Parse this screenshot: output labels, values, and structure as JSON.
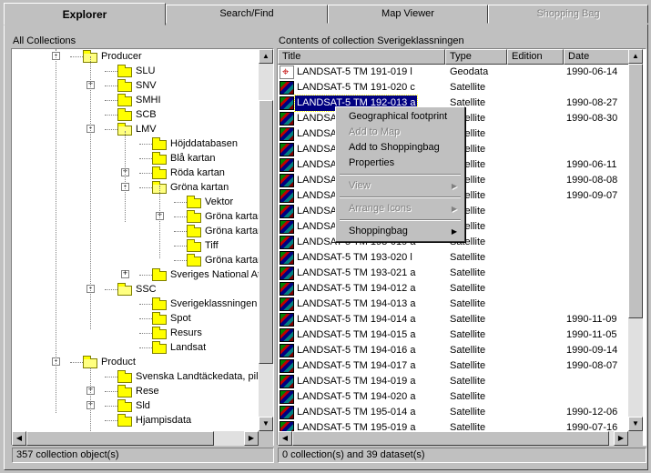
{
  "tabs": [
    {
      "label": "Explorer",
      "state": "active"
    },
    {
      "label": "Search/Find",
      "state": "normal"
    },
    {
      "label": "Map Viewer",
      "state": "normal"
    },
    {
      "label": "Shopping Bag",
      "state": "disabled"
    }
  ],
  "left": {
    "header": "All Collections",
    "status": "357 collection object(s)",
    "tree": [
      {
        "label": "Producer",
        "level": 0,
        "open": true,
        "expander": "-"
      },
      {
        "label": "SLU",
        "level": 1
      },
      {
        "label": "SNV",
        "level": 1,
        "expander": "+"
      },
      {
        "label": "SMHI",
        "level": 1
      },
      {
        "label": "SCB",
        "level": 1
      },
      {
        "label": "LMV",
        "level": 1,
        "open": true,
        "expander": "-"
      },
      {
        "label": "Höjddatabasen",
        "level": 2
      },
      {
        "label": "Blå kartan",
        "level": 2
      },
      {
        "label": "Röda kartan",
        "level": 2,
        "expander": "+"
      },
      {
        "label": "Gröna kartan",
        "level": 2,
        "open": true,
        "expander": "-"
      },
      {
        "label": "Vektor",
        "level": 3
      },
      {
        "label": "Gröna kartan",
        "level": 3,
        "expander": "+"
      },
      {
        "label": "Gröna kartan",
        "level": 3
      },
      {
        "label": "Tiff",
        "level": 3
      },
      {
        "label": "Gröna kartan",
        "level": 3
      },
      {
        "label": "Sveriges National At",
        "level": 2,
        "expander": "+"
      },
      {
        "label": "SSC",
        "level": 1,
        "open": true,
        "expander": "-"
      },
      {
        "label": "Sverigeklassningen",
        "level": 2
      },
      {
        "label": "Spot",
        "level": 2
      },
      {
        "label": "Resurs",
        "level": 2
      },
      {
        "label": "Landsat",
        "level": 2
      },
      {
        "label": "Product",
        "level": 0,
        "open": true,
        "expander": "-"
      },
      {
        "label": "Svenska Landtäckedata, pil",
        "level": 1
      },
      {
        "label": "Rese",
        "level": 1,
        "expander": "+"
      },
      {
        "label": "Sld",
        "level": 1,
        "expander": "+"
      },
      {
        "label": "Hjampisdata",
        "level": 1
      }
    ]
  },
  "right": {
    "header": "Contents of collection Sverigeklassningen",
    "status": "0 collection(s) and  39 dataset(s)",
    "columns": [
      "Title",
      "Type",
      "Edition",
      "Date"
    ],
    "rows": [
      {
        "title": "LANDSAT-5 TM 191-019 l",
        "type": "Geodata",
        "date": "1990-06-14",
        "icon": "geo"
      },
      {
        "title": "LANDSAT-5 TM 191-020 c",
        "type": "Satellite",
        "date": ""
      },
      {
        "title": "LANDSAT-5 TM 192-013 a",
        "type": "Satellite",
        "date": "1990-08-27",
        "selected": true
      },
      {
        "title": "LANDSAT-5 TM 192-014 a",
        "type": "Satellite",
        "date": "1990-08-30"
      },
      {
        "title": "LANDSAT-5 TM 192-015 a",
        "type": "Satellite",
        "date": ""
      },
      {
        "title": "LANDSAT-5 TM 192-016 a",
        "type": "Satellite",
        "date": ""
      },
      {
        "title": "LANDSAT-5 TM 192-017 a",
        "type": "Satellite",
        "date": "1990-06-11"
      },
      {
        "title": "LANDSAT-5 TM 192-018 a",
        "type": "Satellite",
        "date": "1990-08-08"
      },
      {
        "title": "LANDSAT-5 TM 192-019 a",
        "type": "Satellite",
        "date": "1990-09-07"
      },
      {
        "title": "LANDSAT-5 TM 192-020 a",
        "type": "Satellite",
        "date": ""
      },
      {
        "title": "LANDSAT-5 TM 193-013 a",
        "type": "Satellite",
        "date": ""
      },
      {
        "title": "LANDSAT-5 TM 193-019 a",
        "type": "Satellite",
        "date": ""
      },
      {
        "title": "LANDSAT-5 TM 193-020 l",
        "type": "Satellite",
        "date": ""
      },
      {
        "title": "LANDSAT-5 TM 193-021 a",
        "type": "Satellite",
        "date": ""
      },
      {
        "title": "LANDSAT-5 TM 194-012 a",
        "type": "Satellite",
        "date": ""
      },
      {
        "title": "LANDSAT-5 TM 194-013 a",
        "type": "Satellite",
        "date": ""
      },
      {
        "title": "LANDSAT-5 TM 194-014 a",
        "type": "Satellite",
        "date": "1990-11-09"
      },
      {
        "title": "LANDSAT-5 TM 194-015 a",
        "type": "Satellite",
        "date": "1990-11-05"
      },
      {
        "title": "LANDSAT-5 TM 194-016 a",
        "type": "Satellite",
        "date": "1990-09-14"
      },
      {
        "title": "LANDSAT-5 TM 194-017 a",
        "type": "Satellite",
        "date": "1990-08-07"
      },
      {
        "title": "LANDSAT-5 TM 194-019 a",
        "type": "Satellite",
        "date": ""
      },
      {
        "title": "LANDSAT-5 TM 194-020 a",
        "type": "Satellite",
        "date": ""
      },
      {
        "title": "LANDSAT-5 TM 195-014 a",
        "type": "Satellite",
        "date": "1990-12-06"
      },
      {
        "title": "LANDSAT-5 TM 195-019 a",
        "type": "Satellite",
        "date": "1990-07-16"
      },
      {
        "title": "LANDSAT-5 TM 195-020 a",
        "type": "Satellite",
        "date": ""
      }
    ]
  },
  "context_menu": {
    "items": [
      {
        "label": "Geographical footprint",
        "enabled": true
      },
      {
        "label": "Add to Map",
        "enabled": false
      },
      {
        "label": "Add to Shoppingbag",
        "enabled": true
      },
      {
        "label": "Properties",
        "enabled": true
      },
      {
        "sep": true
      },
      {
        "label": "View",
        "enabled": false,
        "submenu": true
      },
      {
        "sep": true
      },
      {
        "label": "Arrange Icons",
        "enabled": false,
        "submenu": true
      },
      {
        "sep": true
      },
      {
        "label": "Shoppingbag",
        "enabled": true,
        "submenu": true
      }
    ]
  },
  "icons": {
    "expand": "+",
    "collapse": "-",
    "arrow_up": "▲",
    "arrow_down": "▼",
    "arrow_left": "◀",
    "arrow_right": "▶",
    "submenu": "▶"
  }
}
